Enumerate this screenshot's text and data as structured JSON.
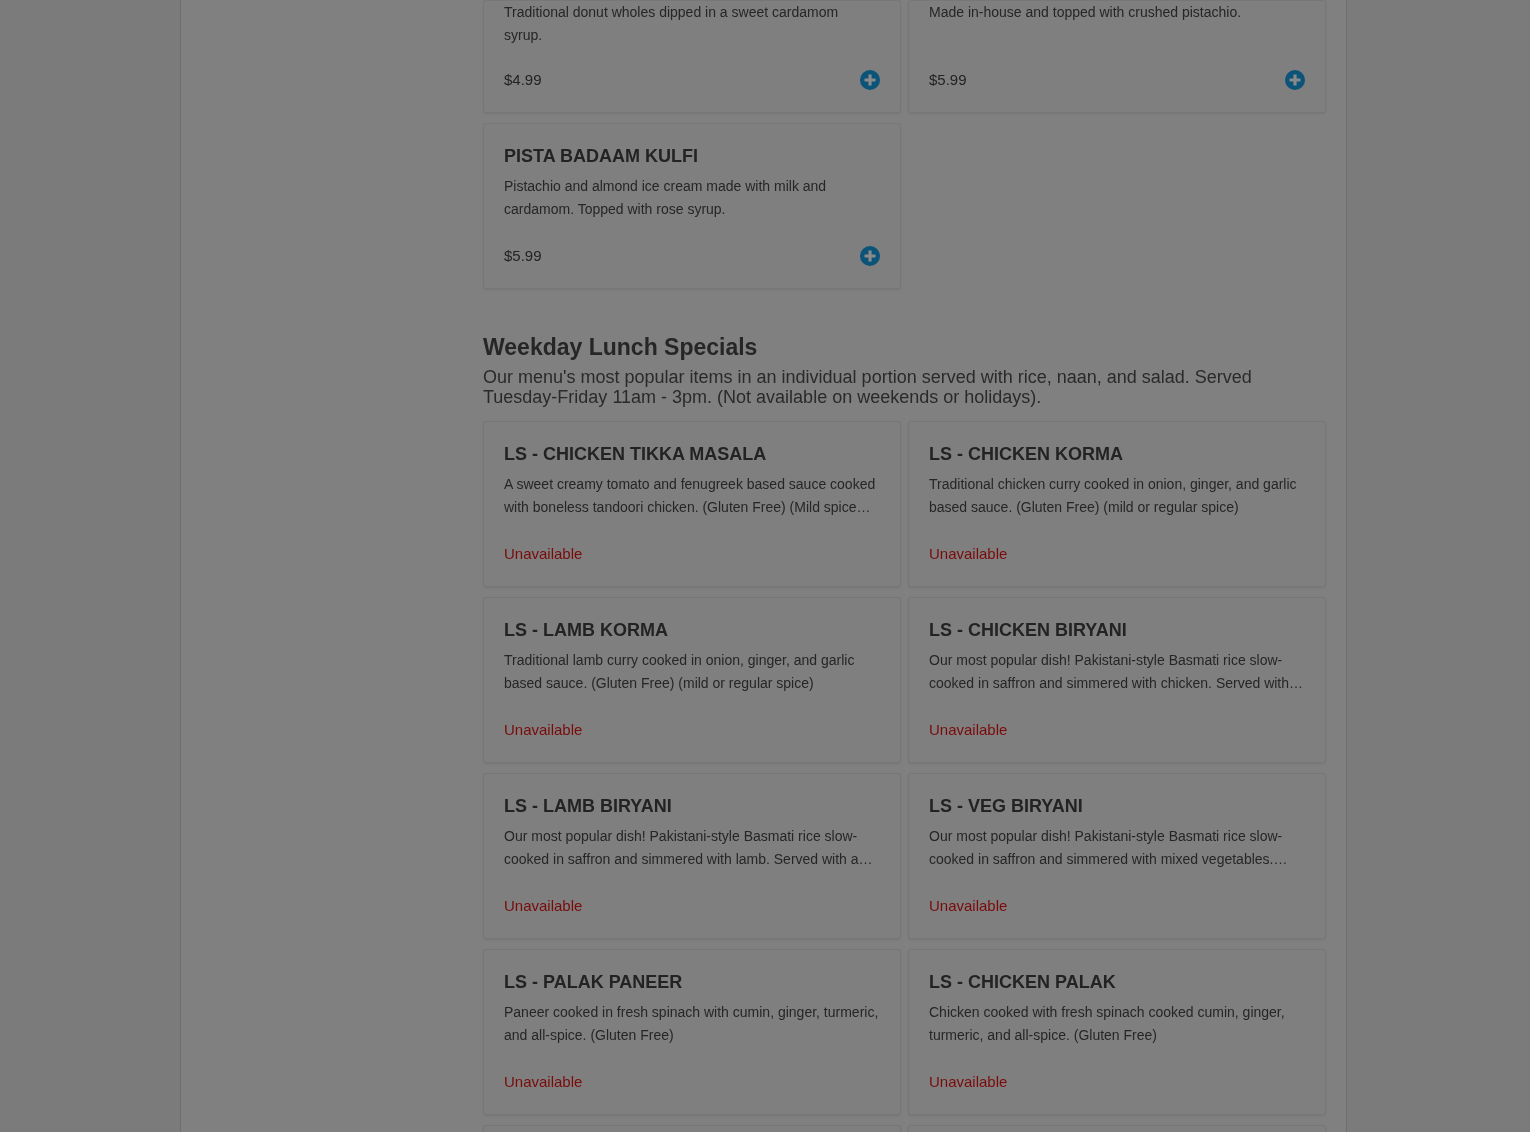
{
  "sections": [
    {
      "items": [
        {
          "description": "Traditional donut wholes dipped in a sweet cardamom syrup.",
          "price": "$4.99",
          "add_button": true
        },
        {
          "description": "Made in-house and topped with crushed pistachio.",
          "price": "$5.99",
          "add_button": true
        },
        {
          "name": "PISTA BADAAM KULFI",
          "description": "Pistachio and almond ice cream made with milk and cardamom. Topped with rose syrup.",
          "price": "$5.99",
          "add_button": true
        }
      ]
    },
    {
      "title": "Weekday Lunch Specials",
      "description": "Our menu's most popular items in an individual portion served with rice, naan, and salad. Served Tuesday-Friday 11am - 3pm. (Not available on weekends or holidays).",
      "items": [
        {
          "name": "LS - CHICKEN TIKKA MASALA",
          "description": "A sweet creamy tomato and fenugreek based sauce cooked with boneless tandoori chicken. (Gluten Free) (Mild spice…",
          "status": "Unavailable"
        },
        {
          "name": "LS - CHICKEN KORMA",
          "description": "Traditional chicken curry cooked in onion, ginger, and garlic based sauce. (Gluten Free) (mild or regular spice)",
          "status": "Unavailable"
        },
        {
          "name": "LS - LAMB KORMA",
          "description": "Traditional lamb curry cooked in onion, ginger, and garlic based sauce. (Gluten Free) (mild or regular spice)",
          "status": "Unavailable"
        },
        {
          "name": "LS - CHICKEN BIRYANI",
          "description": "Our most popular dish! Pakistani-style Basmati rice slow-cooked in saffron and simmered with chicken. Served with…",
          "status": "Unavailable"
        },
        {
          "name": "LS - LAMB BIRYANI",
          "description": "Our most popular dish! Pakistani-style Basmati rice slow-cooked in saffron and simmered with lamb. Served with a…",
          "status": "Unavailable"
        },
        {
          "name": "LS - VEG BIRYANI",
          "description": "Our most popular dish! Pakistani-style Basmati rice slow-cooked in saffron and simmered with mixed vegetables.…",
          "status": "Unavailable"
        },
        {
          "name": "LS - PALAK PANEER",
          "description": "Paneer cooked in fresh spinach with cumin, ginger, turmeric, and all-spice. (Gluten Free)",
          "status": "Unavailable"
        },
        {
          "name": "LS - CHICKEN PALAK",
          "description": "Chicken cooked with fresh spinach cooked cumin, ginger, turmeric, and all-spice. (Gluten Free)",
          "status": "Unavailable"
        }
      ]
    }
  ]
}
